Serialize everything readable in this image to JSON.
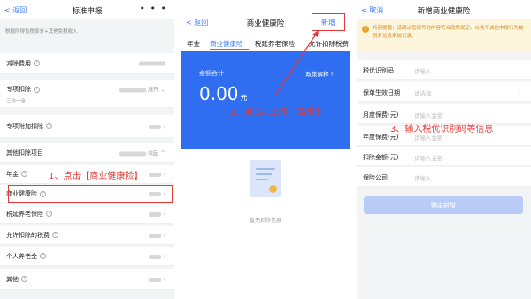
{
  "panel1": {
    "back": "返回",
    "title": "标准申报",
    "more": "• • •",
    "note": "税额所得免税部分+其他免税收入",
    "deduction_expense": "减除费用",
    "special_deduction": "专项扣除",
    "special_expand": "展开",
    "special_sub": "三险一金",
    "special_additional": "专项附加扣除",
    "other_deduction": "其他扣除项目",
    "other_collapse": "收起",
    "items": [
      "年金",
      "商业健康险",
      "税延养老保险",
      "允许扣除的税费",
      "个人养老金",
      "其他"
    ],
    "step1": "1、点击【商业健康险】"
  },
  "panel2": {
    "back": "返回",
    "title": "商业健康险",
    "action": "新增",
    "tabs": [
      "年金",
      "商业健康险",
      "税延养老保险",
      "允许扣除税费"
    ],
    "total_caption": "金额合计",
    "policy_link": "政策解释",
    "amount": "0.00",
    "unit": "元",
    "empty": "暂无扣除信息",
    "step2": "2、点击右上角【新增】"
  },
  "panel3": {
    "cancel": "取消",
    "title": "新增商业健康险",
    "warning": "特别提醒：请确认您填写的内容符合政策规定。以免不诚信申报行为被税务信息系统记录。",
    "fields": [
      {
        "label": "税优识别码",
        "placeholder": "请输入"
      },
      {
        "label": "保单生效日期",
        "placeholder": "请选择"
      },
      {
        "label": "月度保费(元)",
        "placeholder": "请输入金额"
      },
      {
        "label": "年度保费(元)",
        "placeholder": "请输入金额"
      },
      {
        "label": "扣除金额(元)",
        "placeholder": "请输入金额"
      },
      {
        "label": "保险公司",
        "placeholder": "请输入"
      }
    ],
    "submit": "确定新增",
    "step3": "3、输入税优识别码等信息"
  },
  "colors": {
    "accent": "#3d7cf5",
    "card": "#2f6ef0",
    "annotation": "#e53935",
    "warning": "#d18c1c"
  }
}
